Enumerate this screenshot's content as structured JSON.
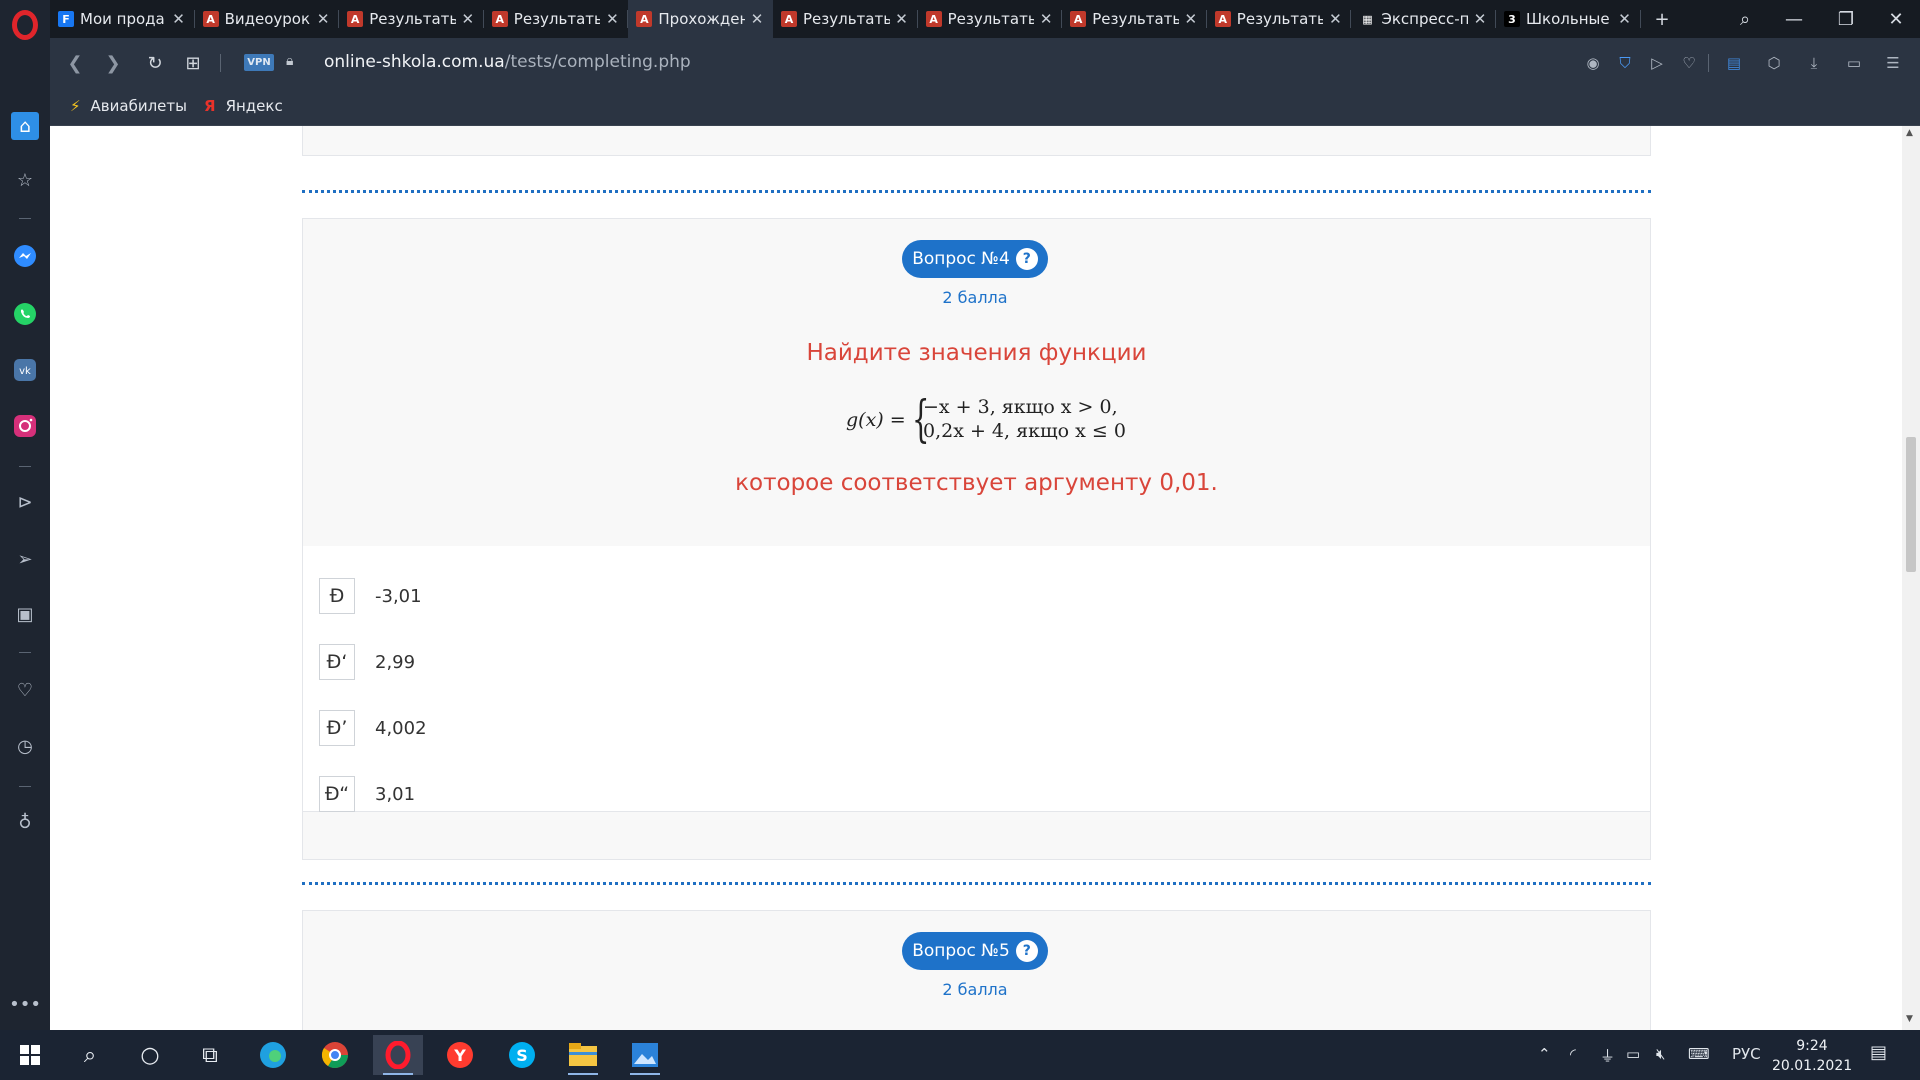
{
  "browser": {
    "tabs": [
      {
        "title": "Мои прода",
        "fav": "F",
        "fav_color": "#1877f2"
      },
      {
        "title": "Видеоурок",
        "fav": "A",
        "fav_color": "#c0392b"
      },
      {
        "title": "Результаты",
        "fav": "A",
        "fav_color": "#c0392b"
      },
      {
        "title": "Результаты",
        "fav": "A",
        "fav_color": "#c0392b"
      },
      {
        "title": "Прохожден",
        "fav": "A",
        "fav_color": "#c0392b",
        "active": true
      },
      {
        "title": "Результаты",
        "fav": "A",
        "fav_color": "#c0392b"
      },
      {
        "title": "Результаты",
        "fav": "A",
        "fav_color": "#c0392b"
      },
      {
        "title": "Результаты",
        "fav": "A",
        "fav_color": "#c0392b"
      },
      {
        "title": "Результаты",
        "fav": "A",
        "fav_color": "#c0392b"
      },
      {
        "title": "Экспресс-п",
        "fav": "▦",
        "fav_color": "#161b22"
      },
      {
        "title": "Школьные",
        "fav": "3",
        "fav_color": "#000000"
      }
    ],
    "url_host": "online-shkola.com.ua",
    "url_path": "/tests/completing.php",
    "vpn_label": "VPN",
    "bookmarks": [
      {
        "label": "Авиабилеты",
        "icon": "plane-icon"
      },
      {
        "label": "Яндекс",
        "icon": "yandex-icon"
      }
    ]
  },
  "question4": {
    "badge": "Вопрос №4",
    "help": "?",
    "points": "2 балла",
    "prompt": "Найдите значения функции",
    "formula_lhs": "g(x) =",
    "formula_line1": "−x + 3, якщо x > 0,",
    "formula_line2": "0,2x + 4, якщо x ≤ 0",
    "prompt2": "которое соответствует аргументу 0,01.",
    "answers": [
      {
        "marker": "Ð",
        "value": "-3,01"
      },
      {
        "marker": "Ð‘",
        "value": "2,99"
      },
      {
        "marker": "Ð’",
        "value": "4,002"
      },
      {
        "marker": "Ð“",
        "value": "3,01"
      }
    ]
  },
  "question5": {
    "badge": "Вопрос №5",
    "help": "?",
    "points": "2 балла"
  },
  "taskbar": {
    "lang": "РУС",
    "time": "9:24",
    "date": "20.01.2021"
  },
  "colors": {
    "accent": "#1e72c9",
    "question_text": "#d9453a",
    "sidebar_bg": "#1e2530",
    "tab_bg": "#161b22"
  }
}
